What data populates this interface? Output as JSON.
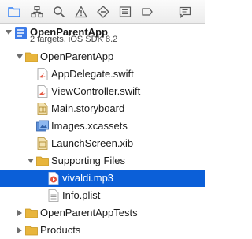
{
  "toolbar": {
    "icons": [
      "folder-icon",
      "hierarchy-icon",
      "search-icon",
      "warning-icon",
      "diamond-icon",
      "list-icon",
      "tag-icon",
      "comment-icon"
    ]
  },
  "project": {
    "name": "OpenParentApp",
    "subtitle": "2 targets, iOS SDK 8.2"
  },
  "tree": {
    "group_app": "OpenParentApp",
    "app_delegate": "AppDelegate.swift",
    "view_controller": "ViewController.swift",
    "main_storyboard": "Main.storyboard",
    "images": "Images.xcassets",
    "launch_screen": "LaunchScreen.xib",
    "supporting_files": "Supporting Files",
    "vivaldi": "vivaldi.mp3",
    "info_plist": "Info.plist",
    "tests": "OpenParentAppTests",
    "products": "Products"
  },
  "colors": {
    "selection": "#0b5fd8",
    "folder": "#e8b53c",
    "toolbar_active": "#2c7cf6"
  }
}
